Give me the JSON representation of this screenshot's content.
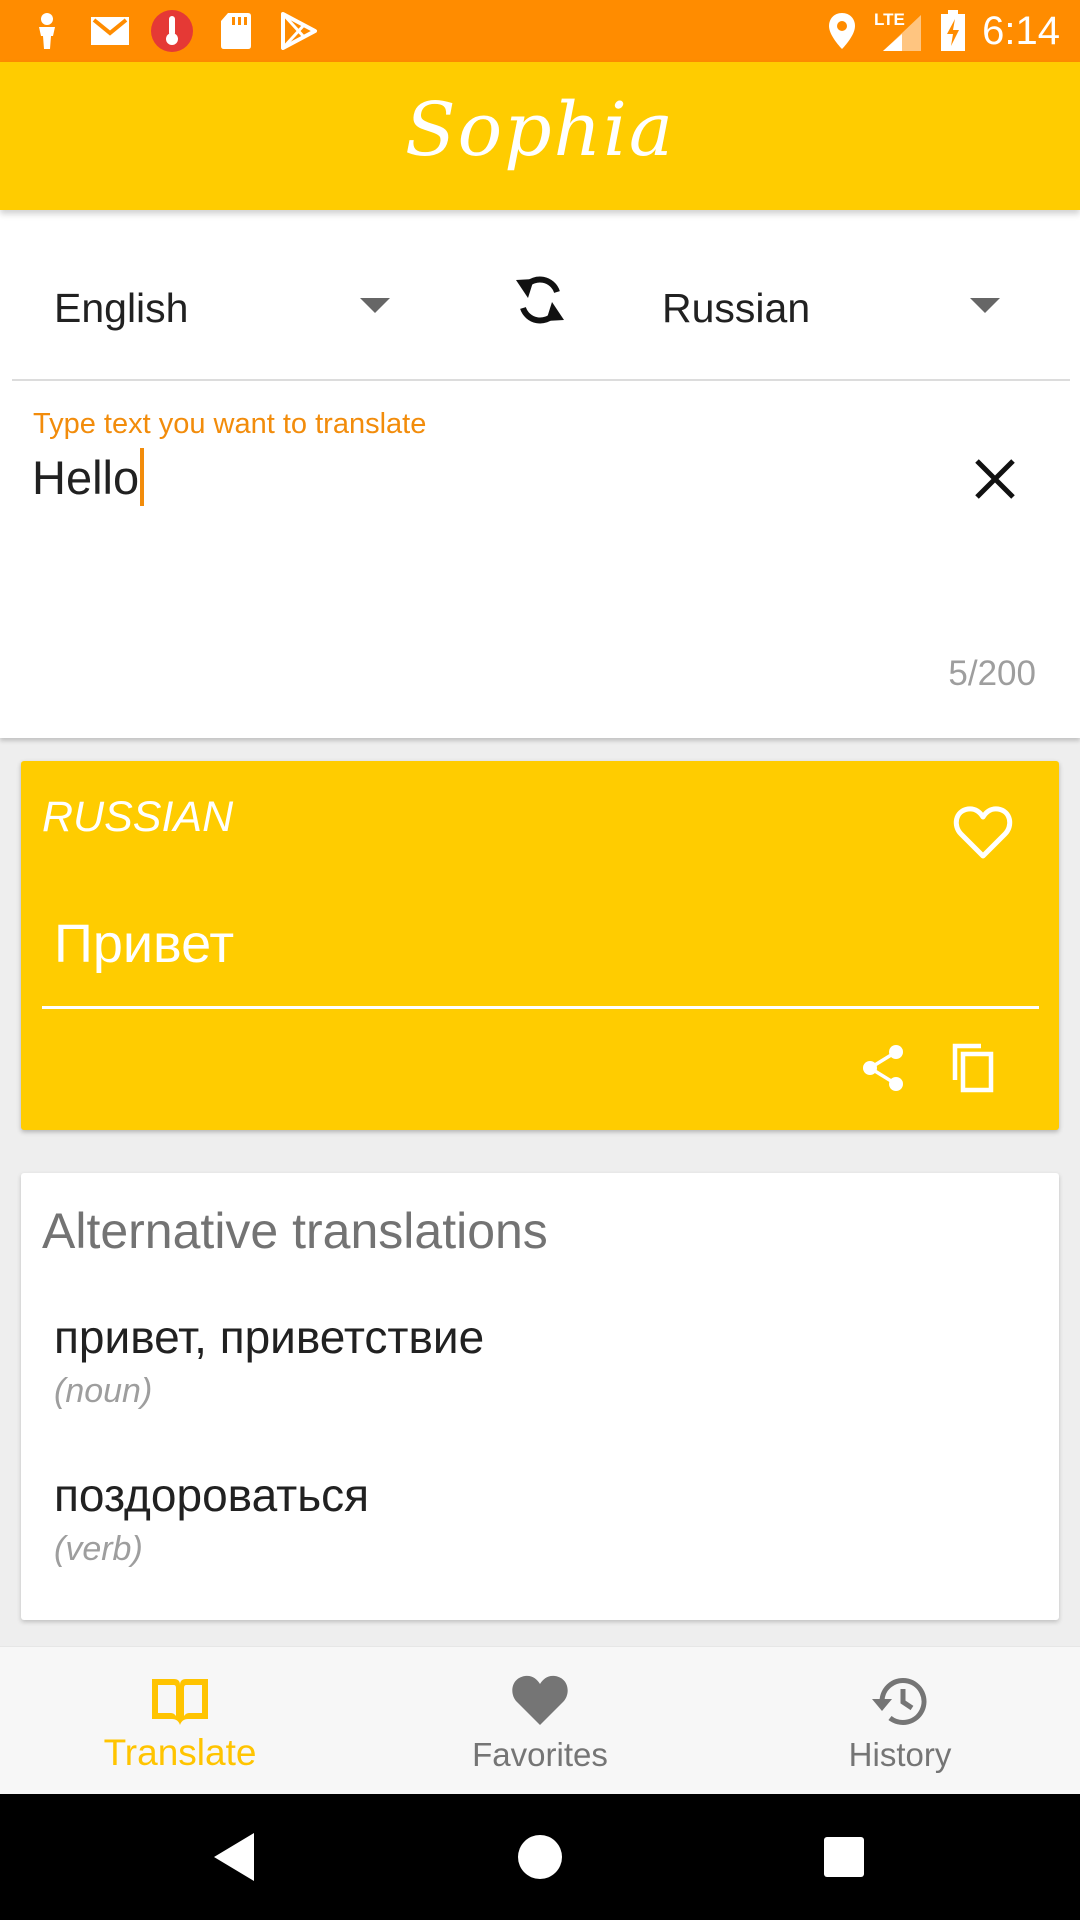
{
  "status_bar": {
    "time": "6:14",
    "background": "#ff8c00",
    "icons_left": [
      "person-icon",
      "gmail-icon",
      "temperature-alert-icon",
      "sd-card-icon",
      "play-store-icon"
    ],
    "icons_right": [
      "location-pin-icon",
      "lte-signal-icon",
      "battery-charging-icon"
    ],
    "network_label": "LTE"
  },
  "app_bar": {
    "title": "Sophia",
    "background": "#ffcc00"
  },
  "translator": {
    "source_language": "English",
    "target_language": "Russian",
    "input_label": "Type text you want to translate",
    "input_value": "Hello",
    "char_counter": "5/200",
    "accent": "#f28c0b"
  },
  "result": {
    "language_label": "RUSSIAN",
    "translation": "Привет",
    "background": "#ffcc00"
  },
  "alternatives": {
    "title": "Alternative translations",
    "items": [
      {
        "word": "привет, приветствие",
        "part_of_speech": "(noun)"
      },
      {
        "word": "поздороваться",
        "part_of_speech": "(verb)"
      }
    ]
  },
  "bottom_nav": {
    "items": [
      {
        "label": "Translate",
        "icon": "book-icon",
        "active": true
      },
      {
        "label": "Favorites",
        "icon": "heart-icon",
        "active": false
      },
      {
        "label": "History",
        "icon": "history-icon",
        "active": false
      }
    ],
    "active_color": "#ffc400",
    "inactive_color": "#757575"
  },
  "system_nav": {
    "buttons": [
      "back-icon",
      "home-icon",
      "recents-icon"
    ]
  }
}
